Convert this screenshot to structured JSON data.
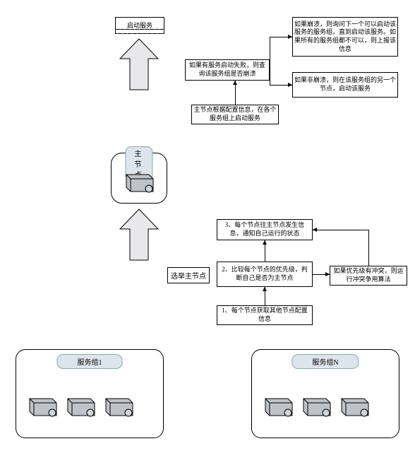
{
  "banners": {
    "start_service": "启动服务",
    "elect_master": "选举主节点"
  },
  "master": {
    "title": "主节点"
  },
  "top_flow": {
    "check_crash": "如果有服务启动失败，则查询该服务组是否崩溃",
    "master_config": "主节点根据配置信息，在各个服务组上启动服务",
    "crash_yes": "如果崩溃，则询问下一个可以启动该服务的服务组，直到启动该服务。如果所有的服务组都不可以，则上报该信息",
    "crash_no": "如果非崩溃，则在该服务组的另一个节点，启动该服务"
  },
  "bottom_flow": {
    "step1": "1、每个节点获取其他节点配置信息",
    "step2": "2、比较每个节点的优先级，判断自己是否为主节点",
    "step3": "3、每个节点往主节点发生信息，通知自己运行的状态",
    "conflict": "如果优先级有冲突，则运行冲突争用算法"
  },
  "groups": {
    "g1": "服务组1",
    "gn": "服务组N"
  }
}
